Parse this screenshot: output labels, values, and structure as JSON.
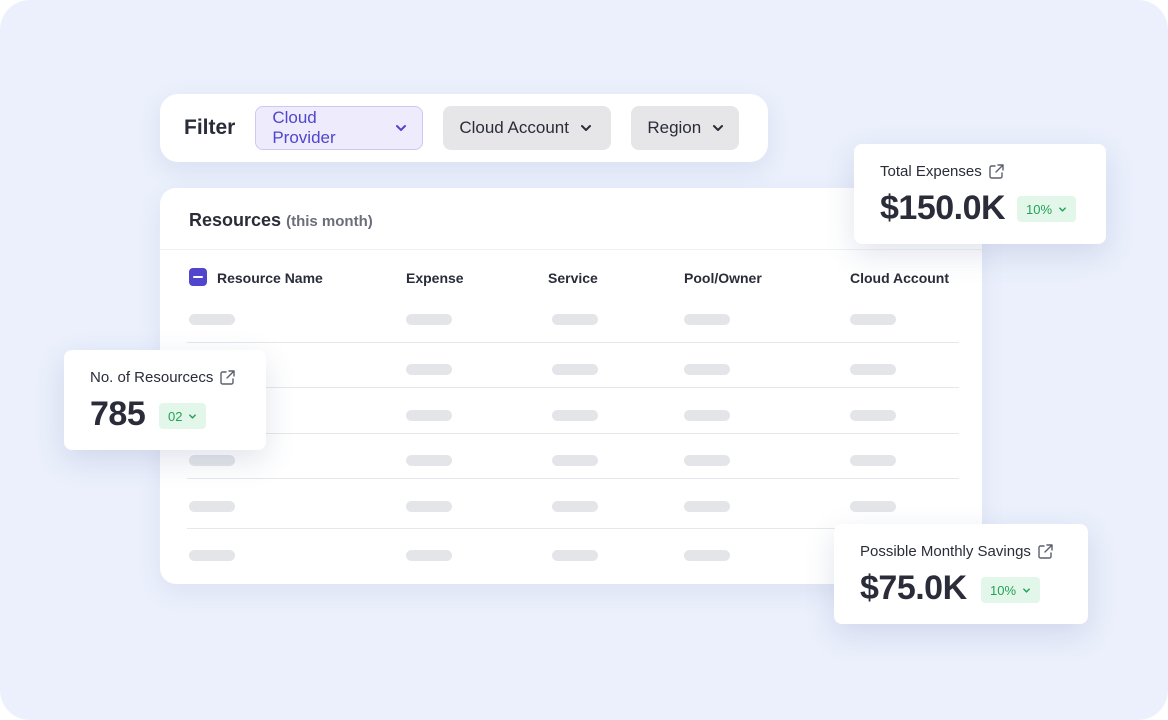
{
  "filter": {
    "label": "Filter",
    "dropdowns": [
      {
        "label": "Cloud Provider",
        "active": true
      },
      {
        "label": "Cloud Account",
        "active": false
      },
      {
        "label": "Region",
        "active": false
      }
    ]
  },
  "resources": {
    "title": "Resources",
    "subtitle": "(this month)",
    "columns": [
      "Resource Name",
      "Expense",
      "Service",
      "Pool/Owner",
      "Cloud Account"
    ]
  },
  "stats": {
    "total_expenses": {
      "label": "Total Expenses",
      "value": "$150.0K",
      "badge": "10%"
    },
    "resources_count": {
      "label": "No. of Resourcecs",
      "value": "785",
      "badge": "02"
    },
    "monthly_savings": {
      "label": "Possible Monthly Savings",
      "value": "$75.0K",
      "badge": "10%"
    }
  },
  "colors": {
    "background": "#ebf0fc",
    "accent": "#5145cd",
    "badge_bg": "#e3f6ea",
    "badge_text": "#23a256"
  },
  "icons": [
    "chevron-down-icon",
    "external-link-icon",
    "checkbox-indeterminate-icon"
  ]
}
